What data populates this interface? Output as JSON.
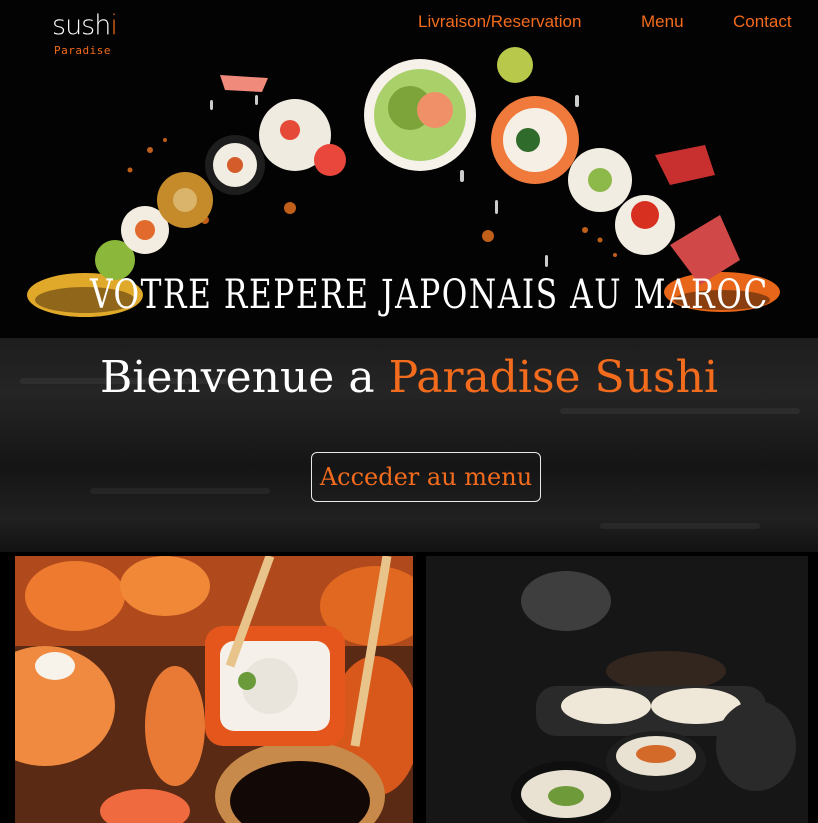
{
  "logo": {
    "word": "sush",
    "bar": "i",
    "sub": "Paradise"
  },
  "nav": [
    {
      "label": "Livraison/Reservation"
    },
    {
      "label": "Menu"
    },
    {
      "label": "Contact"
    }
  ],
  "hero": {
    "tagline": "Votre repere japonais au Maroc"
  },
  "welcome": {
    "title_white": "Bienvenue a",
    "title_orange": "Paradise Sushi",
    "button_label": "Acceder au menu"
  },
  "colors": {
    "accent": "#f36b1c",
    "background": "#000000"
  }
}
